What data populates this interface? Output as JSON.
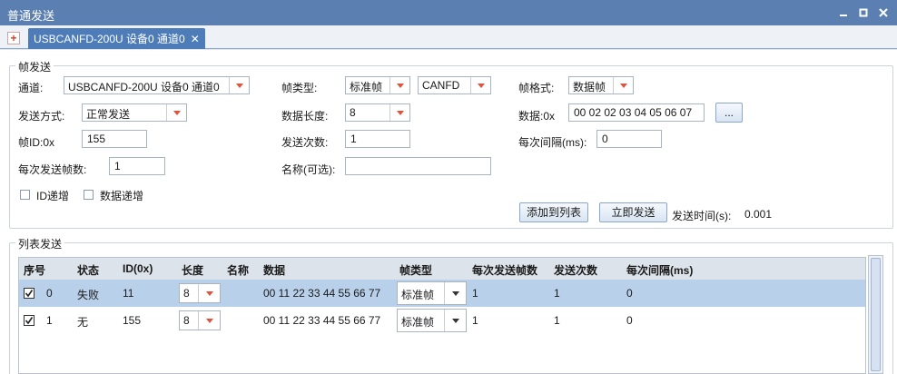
{
  "window": {
    "title": "普通发送"
  },
  "tabs": {
    "add_symbol": "+",
    "active_label": "USBCANFD-200U 设备0 通道0",
    "close_symbol": "✕"
  },
  "frame_send": {
    "legend": "帧发送",
    "channel": {
      "label": "通道:",
      "value": "USBCANFD-200U 设备0 通道0"
    },
    "frame_type": {
      "label": "帧类型:",
      "value": "标准帧",
      "protocol": "CANFD"
    },
    "frame_format": {
      "label": "帧格式:",
      "value": "数据帧"
    },
    "send_mode": {
      "label": "发送方式:",
      "value": "正常发送"
    },
    "data_length": {
      "label": "数据长度:",
      "value": "8"
    },
    "data": {
      "label": "数据:0x",
      "value": "00 02 02 03 04 05 06 07",
      "more_button": "..."
    },
    "frame_id": {
      "label": "帧ID:0x",
      "value": "155"
    },
    "send_count": {
      "label": "发送次数:",
      "value": "1"
    },
    "interval": {
      "label": "每次间隔(ms):",
      "value": "0"
    },
    "frames_per_send": {
      "label": "每次发送帧数:",
      "value": "1"
    },
    "name": {
      "label": "名称(可选):",
      "value": ""
    },
    "id_increment": {
      "label": "ID递增",
      "checked": false
    },
    "data_increment": {
      "label": "数据递增",
      "checked": false
    },
    "add_to_list_button": "添加到列表",
    "send_now_button": "立即发送",
    "send_time": {
      "label": "发送时间(s):",
      "value": "0.001"
    }
  },
  "list_send": {
    "legend": "列表发送",
    "columns": [
      "序号",
      "状态",
      "ID(0x)",
      "长度",
      "名称",
      "数据",
      "帧类型",
      "每次发送帧数",
      "发送次数",
      "每次间隔(ms)"
    ],
    "rows": [
      {
        "checked": true,
        "index": "0",
        "status": "失败",
        "id": "11",
        "length": "8",
        "name": "",
        "data": "00 11 22 33 44 55 66 77",
        "frame_type": "标准帧",
        "frames_per_send": "1",
        "send_count": "1",
        "interval": "0",
        "selected": true
      },
      {
        "checked": true,
        "index": "1",
        "status": "无",
        "id": "155",
        "length": "8",
        "name": "",
        "data": "00 11 22 33 44 55 66 77",
        "frame_type": "标准帧",
        "frames_per_send": "1",
        "send_count": "1",
        "interval": "0",
        "selected": false
      }
    ]
  },
  "colors": {
    "titlebar": "#5a7fb0",
    "tab_active": "#4d7cb8",
    "selected_row": "#b9d0ea",
    "dropdown_arrow": "#e0523b"
  }
}
